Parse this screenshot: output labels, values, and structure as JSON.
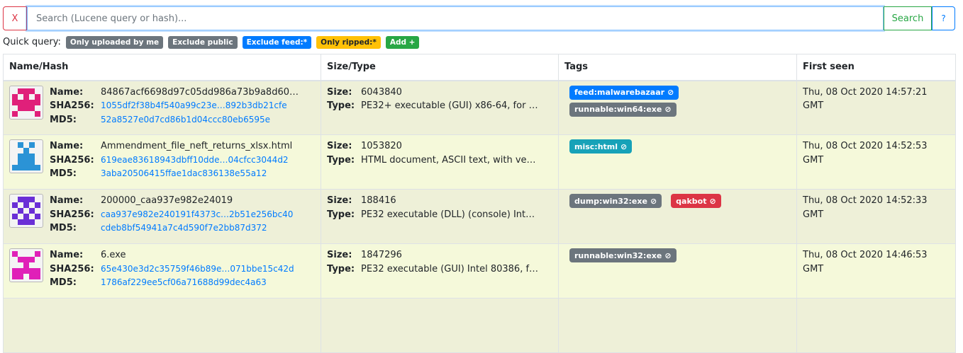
{
  "search": {
    "clear_label": "X",
    "placeholder": "Search (Lucene query or hash)...",
    "value": "",
    "search_label": "Search",
    "help_label": "?"
  },
  "quick_query": {
    "label": "Quick query:",
    "items": [
      {
        "label": "Only uploaded by me",
        "color": "#6c757d"
      },
      {
        "label": "Exclude public",
        "color": "#6c757d"
      },
      {
        "label": "Exclude feed:*",
        "color": "#007bff"
      },
      {
        "label": "Only ripped:*",
        "color": "#ffc107"
      },
      {
        "label": "Add +",
        "color": "#28a745"
      }
    ]
  },
  "table": {
    "headers": [
      "Name/Hash",
      "Size/Type",
      "Tags",
      "First seen"
    ],
    "field_labels": {
      "name": "Name:",
      "sha256": "SHA256:",
      "md5": "MD5:",
      "size": "Size:",
      "type": "Type:"
    },
    "rows": [
      {
        "name": "84867acf6698d97c05dd986a73b9a8d60…",
        "sha256": "1055df2f38b4f540a99c23e…892b3db21cfe",
        "md5": "52a8527e0d7cd86b1d04ccc80eb6595e",
        "size": "6043840",
        "type": "PE32+ executable (GUI) x86-64, for …",
        "tags": [
          {
            "label": "feed:malwarebazaar",
            "color": "#007bff"
          },
          {
            "label": "runnable:win64:exe",
            "color": "#6c757d"
          }
        ],
        "first_seen_1": "Thu, 08 Oct 2020 14:57:21",
        "first_seen_2": "GMT",
        "avatar_color": "#e0207a"
      },
      {
        "name": "Ammendment_file_neft_returns_xlsx.html",
        "sha256": "619eae83618943dbff10dde…04cfcc3044d2",
        "md5": "3aba20506415ffae1dac836138e55a12",
        "size": "1053820",
        "type": "HTML document, ASCII text, with ve…",
        "tags": [
          {
            "label": "misc:html",
            "color": "#17a2b8"
          }
        ],
        "first_seen_1": "Thu, 08 Oct 2020 14:52:53",
        "first_seen_2": "GMT",
        "avatar_color": "#2b93d6"
      },
      {
        "name": "200000_caa937e982e24019",
        "sha256": "caa937e982e240191f4373c…2b51e256bc40",
        "md5": "cdeb8bf54941a7c4d590f7e2bb87d372",
        "size": "188416",
        "type": "PE32 executable (DLL) (console) Int…",
        "tags": [
          {
            "label": "dump:win32:exe",
            "color": "#6c757d"
          },
          {
            "label": "qakbot",
            "color": "#dc3545"
          }
        ],
        "first_seen_1": "Thu, 08 Oct 2020 14:52:33",
        "first_seen_2": "GMT",
        "avatar_color": "#6a2fd6"
      },
      {
        "name": "6.exe",
        "sha256": "65e430e3d2c35759f46b89e…071bbe15c42d",
        "md5": "1786af229ee5cf06a71688d99dec4a63",
        "size": "1847296",
        "type": "PE32 executable (GUI) Intel 80386, f…",
        "tags": [
          {
            "label": "runnable:win32:exe",
            "color": "#6c757d"
          }
        ],
        "first_seen_1": "Thu, 08 Oct 2020 14:46:53",
        "first_seen_2": "GMT",
        "avatar_color": "#e020b8"
      }
    ]
  }
}
